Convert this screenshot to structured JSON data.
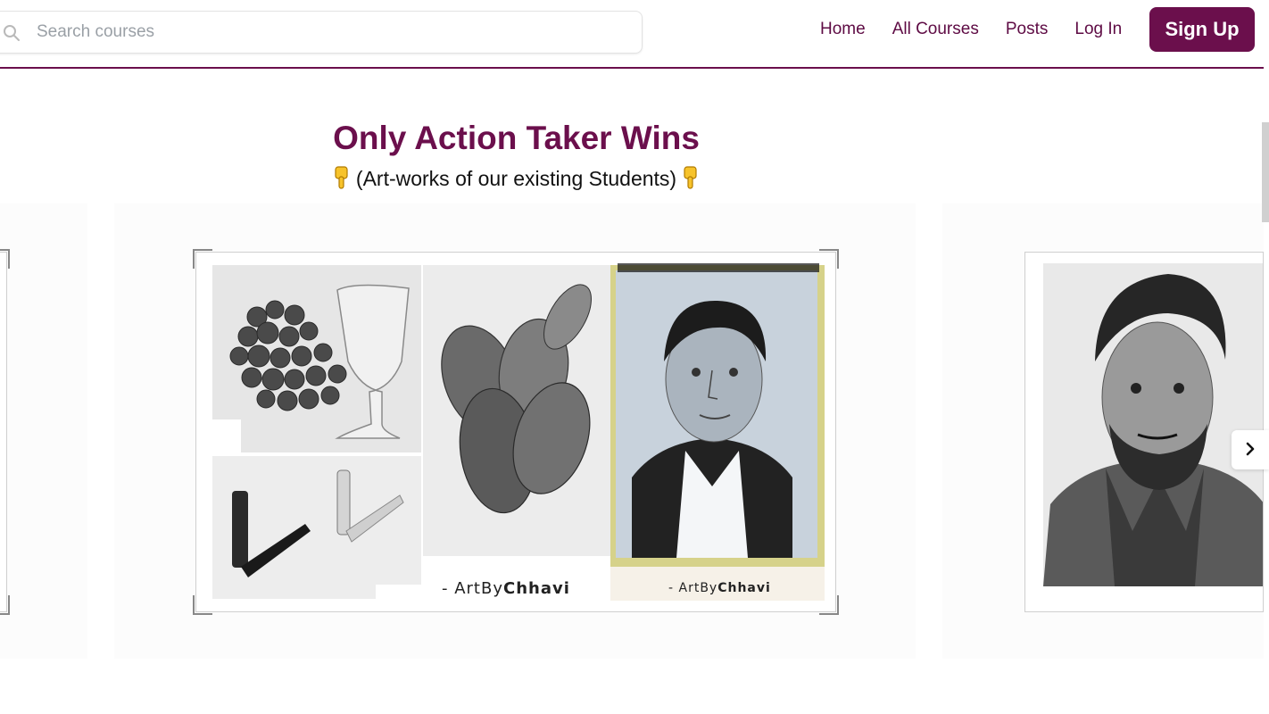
{
  "search": {
    "placeholder": "Search courses",
    "icon": "search-icon"
  },
  "nav": {
    "items": [
      {
        "label": "Home"
      },
      {
        "label": "All Courses"
      },
      {
        "label": "Posts"
      },
      {
        "label": "Log In"
      }
    ],
    "signup_label": "Sign Up"
  },
  "colors": {
    "brand": "#6b0f4c",
    "accent_text": "#5e0b44"
  },
  "section": {
    "title": "Only Action Taker Wins",
    "subtitle": "(Art-works of our existing Students)"
  },
  "slides": [
    {
      "artist_prefix": "- ArtBy",
      "artist_name": "Chhavi"
    },
    {
      "artist_prefix": "- ArtBy",
      "artist_name": "Chhavi"
    }
  ],
  "carousel": {
    "next_icon": "chevron-right-icon"
  }
}
